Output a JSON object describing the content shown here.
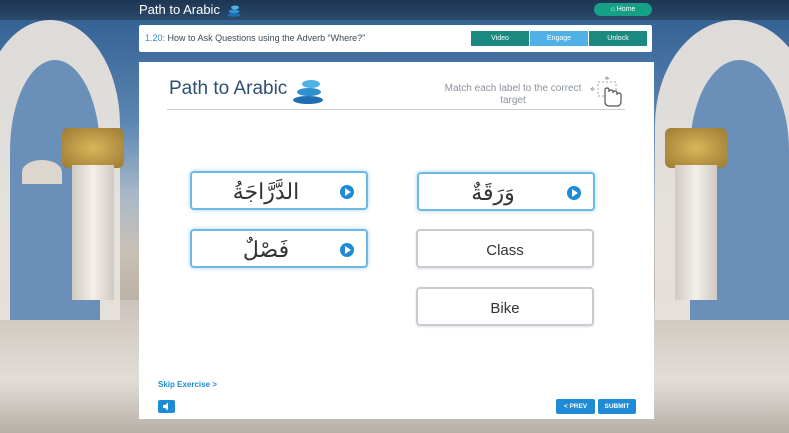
{
  "app": {
    "brand": "Path to Arabic",
    "home_label": "Home"
  },
  "lesson": {
    "number": "1.20:",
    "title": "How to Ask Questions using the Adverb “Where?”",
    "tabs": [
      {
        "label": "Video",
        "active": false
      },
      {
        "label": "Engage",
        "active": true
      },
      {
        "label": "Unlock",
        "active": false
      }
    ]
  },
  "exercise": {
    "logo_text": "Path to Arabic",
    "instruction": "Match each label to the correct target",
    "drag_labels": [
      {
        "text": "الدَّرَّاجَةُ",
        "icon": "play-icon"
      },
      {
        "text": "فَصْلٌ",
        "icon": "play-icon"
      }
    ],
    "targets": [
      {
        "text": "وَرَقَةٌ",
        "icon": "play-icon"
      },
      {
        "text": "Class"
      },
      {
        "text": "Bike"
      }
    ],
    "skip_label": "Skip Exercise >",
    "prev_label": "< PREV",
    "submit_label": "SUBMIT"
  },
  "colors": {
    "accent": "#1f8ad6",
    "tab_bg": "#1a8a80",
    "tab_active": "#4fb1e6",
    "home_btn": "#16a085",
    "card_highlight": "#6cb9e3"
  }
}
